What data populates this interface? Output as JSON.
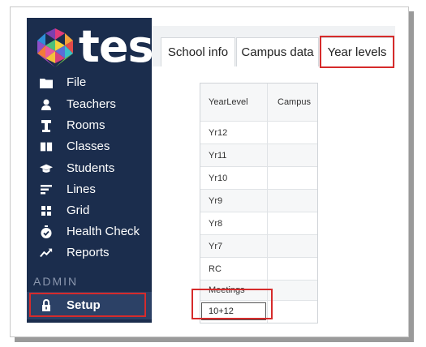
{
  "app": {
    "logo_text": "tes"
  },
  "sidebar": {
    "items": [
      {
        "label": "File",
        "icon": "folder-icon"
      },
      {
        "label": "Teachers",
        "icon": "person-icon"
      },
      {
        "label": "Rooms",
        "icon": "lectern-icon"
      },
      {
        "label": "Classes",
        "icon": "book-icon"
      },
      {
        "label": "Students",
        "icon": "graduation-cap-icon"
      },
      {
        "label": "Lines",
        "icon": "lines-icon"
      },
      {
        "label": "Grid",
        "icon": "grid-icon"
      },
      {
        "label": "Health Check",
        "icon": "stopwatch-check-icon"
      },
      {
        "label": "Reports",
        "icon": "trend-chart-icon"
      }
    ],
    "section_label": "ADMIN",
    "setup": {
      "label": "Setup",
      "icon": "lock-icon"
    }
  },
  "tabs": [
    {
      "label": "School info"
    },
    {
      "label": "Campus data"
    },
    {
      "label": "Year levels",
      "active": true
    }
  ],
  "table": {
    "headers": {
      "level": "YearLevel",
      "campus": "Campus"
    },
    "rows": [
      {
        "level": "Yr12",
        "campus": ""
      },
      {
        "level": "Yr11",
        "campus": ""
      },
      {
        "level": "Yr10",
        "campus": ""
      },
      {
        "level": "Yr9",
        "campus": ""
      },
      {
        "level": "Yr8",
        "campus": ""
      },
      {
        "level": "Yr7",
        "campus": ""
      },
      {
        "level": "RC",
        "campus": ""
      },
      {
        "level": "Meetings",
        "campus": ""
      }
    ],
    "editing_value": "10+12"
  },
  "colors": {
    "sidebar_bg": "#1b2d4d",
    "highlight": "#d62b2b"
  }
}
